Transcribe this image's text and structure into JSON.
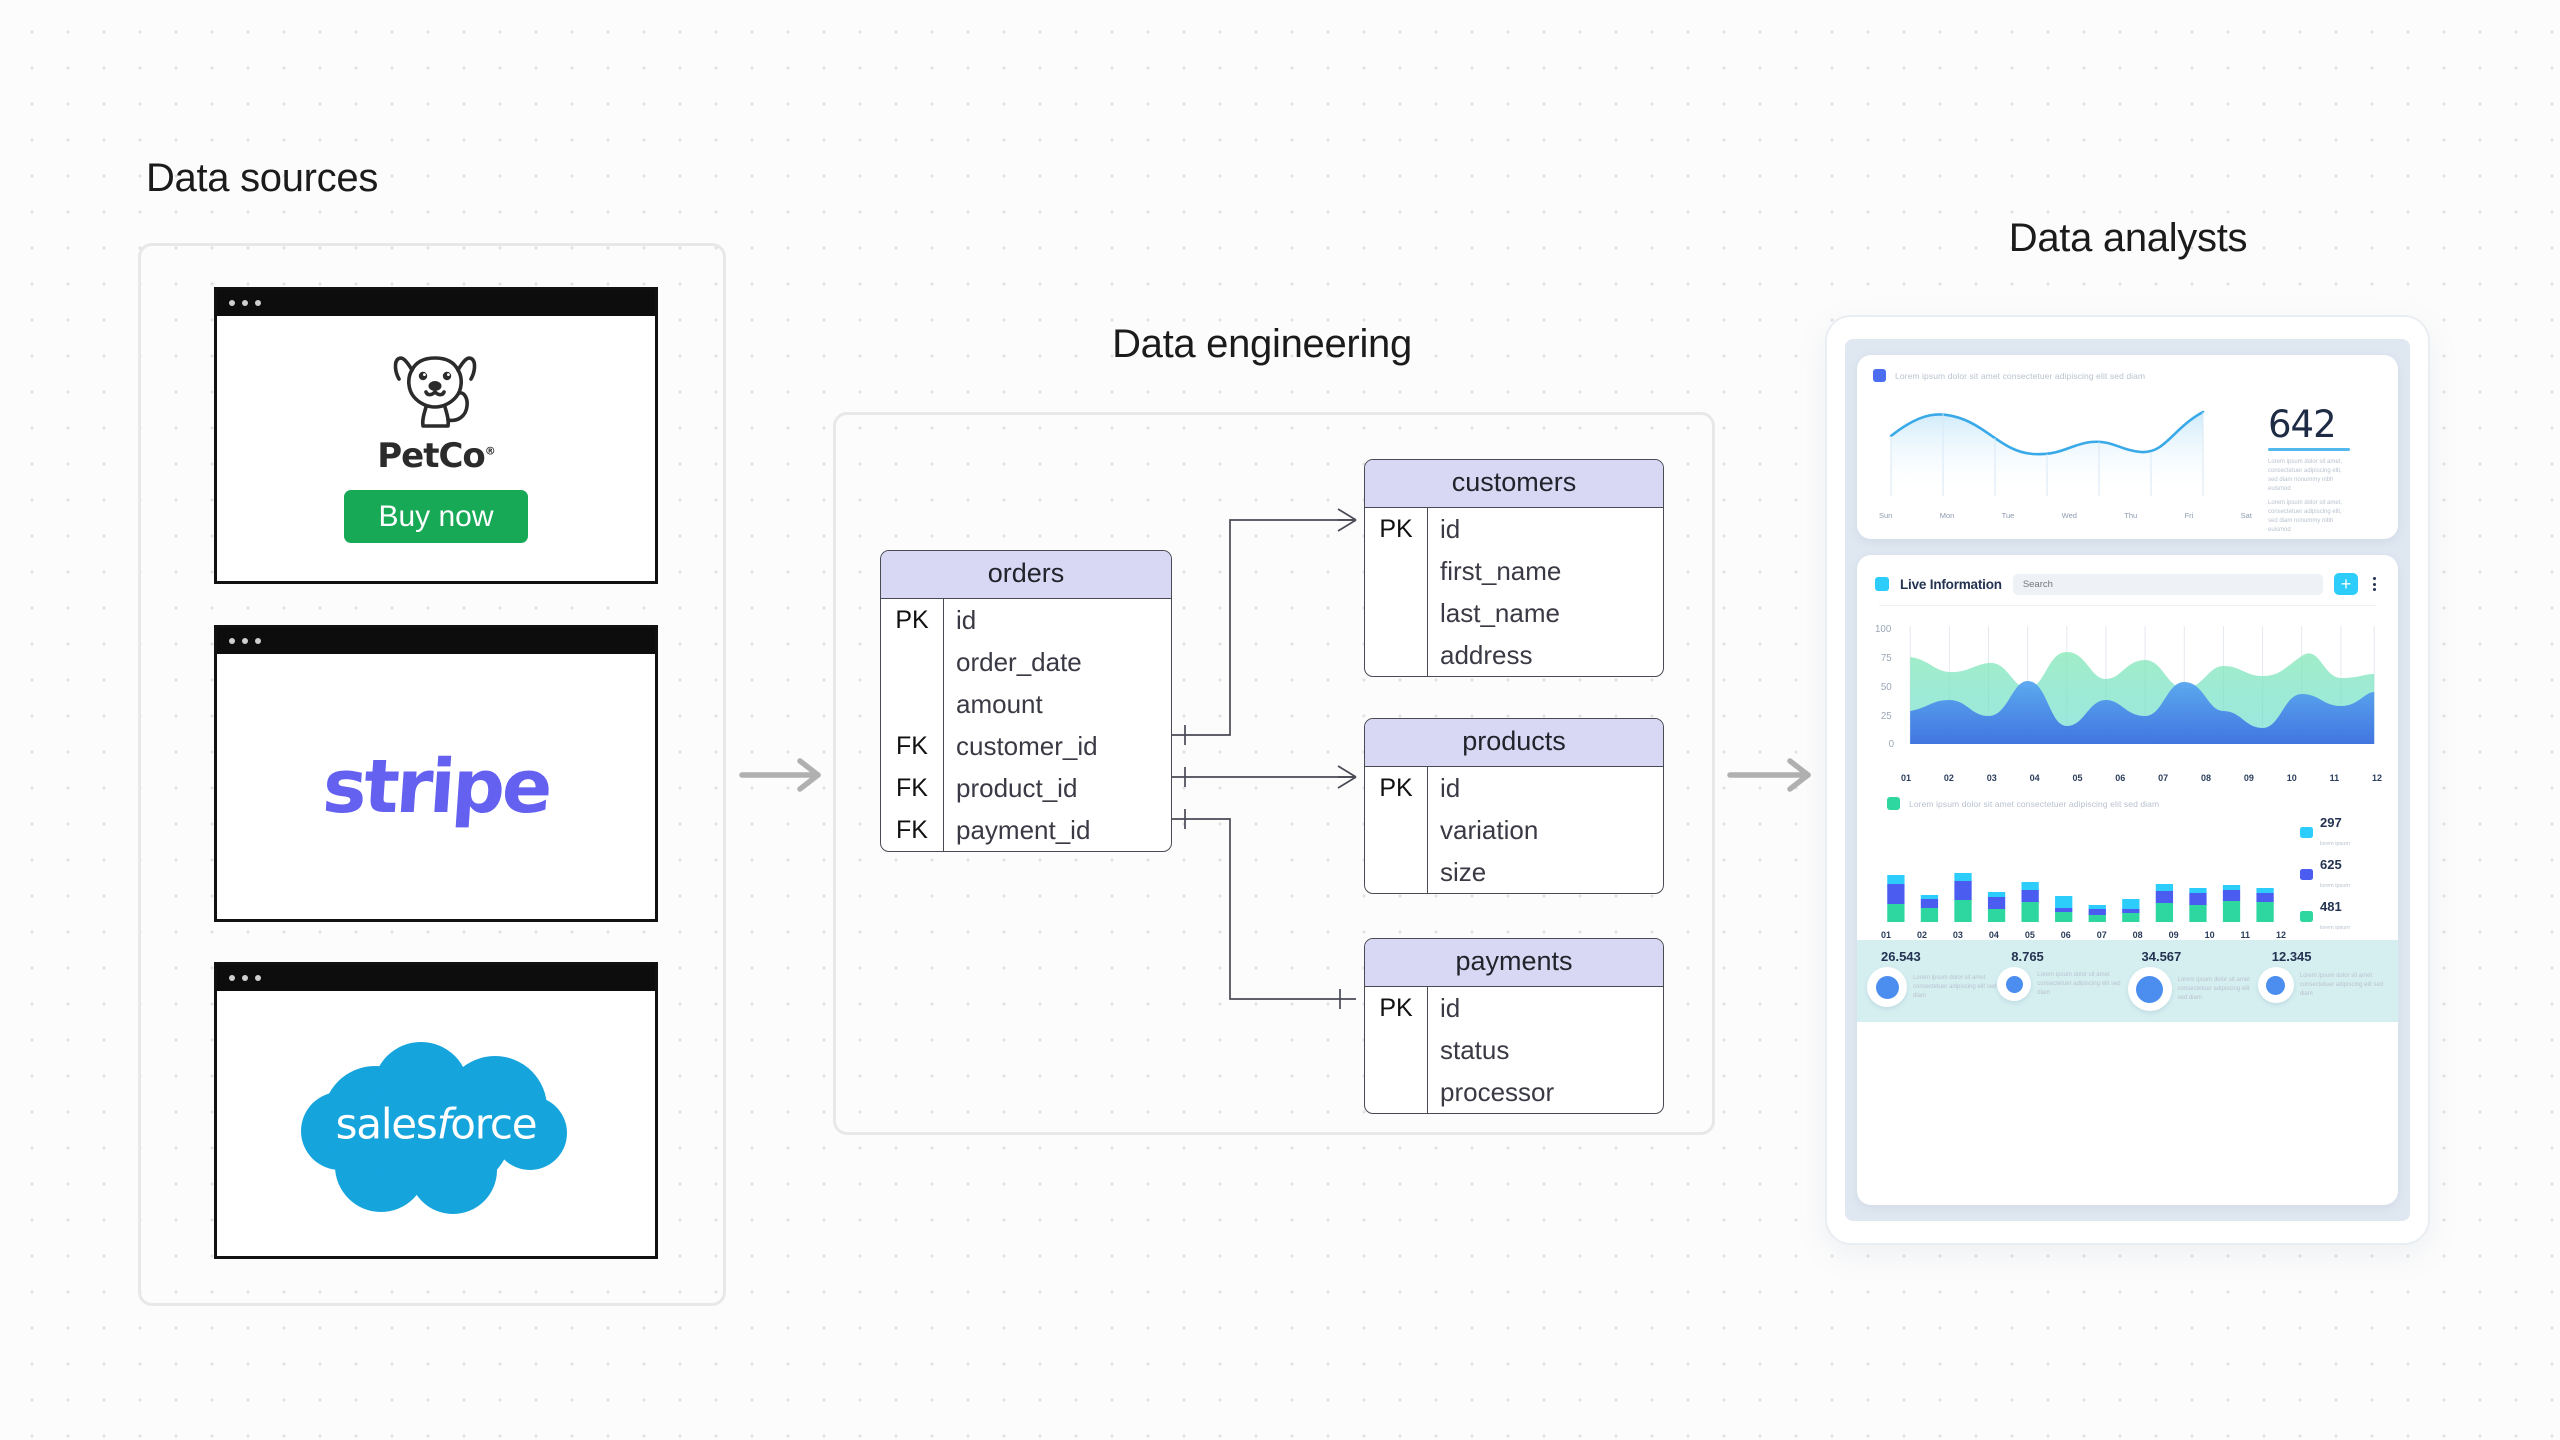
{
  "sections": {
    "sources_title": "Data sources",
    "engineering_title": "Data engineering",
    "analysts_title": "Data analysts"
  },
  "data_sources": {
    "windows": [
      {
        "name": "petco",
        "brand": "PetCo",
        "registered": "®",
        "cta": "Buy now",
        "cta_color": "#18a957"
      },
      {
        "name": "stripe",
        "brand": "stripe",
        "brand_color": "#6460f0"
      },
      {
        "name": "salesforce",
        "brand_lead": "sales",
        "brand_italic": "f",
        "brand_tail": "orce",
        "brand_color": "#16a4dd"
      }
    ]
  },
  "er_diagram": {
    "header_color": "#d8d8f5",
    "tables": [
      {
        "name": "orders",
        "columns": [
          {
            "key": "PK",
            "field": "id"
          },
          {
            "key": "",
            "field": "order_date"
          },
          {
            "key": "",
            "field": "amount"
          },
          {
            "key": "FK",
            "field": "customer_id"
          },
          {
            "key": "FK",
            "field": "product_id"
          },
          {
            "key": "FK",
            "field": "payment_id"
          }
        ]
      },
      {
        "name": "customers",
        "columns": [
          {
            "key": "PK",
            "field": "id"
          },
          {
            "key": "",
            "field": "first_name"
          },
          {
            "key": "",
            "field": "last_name"
          },
          {
            "key": "",
            "field": "address"
          }
        ]
      },
      {
        "name": "products",
        "columns": [
          {
            "key": "PK",
            "field": "id"
          },
          {
            "key": "",
            "field": "variation"
          },
          {
            "key": "",
            "field": "size"
          }
        ]
      },
      {
        "name": "payments",
        "columns": [
          {
            "key": "PK",
            "field": "id"
          },
          {
            "key": "",
            "field": "status"
          },
          {
            "key": "",
            "field": "processor"
          }
        ]
      }
    ],
    "relationships": [
      {
        "from": "orders.customer_id",
        "to": "customers.id"
      },
      {
        "from": "orders.product_id",
        "to": "products.id"
      },
      {
        "from": "orders.payment_id",
        "to": "payments.id"
      }
    ]
  },
  "flow_arrows": [
    {
      "name": "sources-to-engineering"
    },
    {
      "name": "engineering-to-analysts"
    }
  ],
  "dashboard": {
    "top_card": {
      "legend_label": "Lorem ipsum dolor sit amet consectetuer adipiscing elit sed diam",
      "legend_color": "#4b6ef0",
      "kpi_value": "642",
      "kpi_note_1": "Lorem ipsum dolor sit amet, consectetuer adipiscing elit, sed diam nonummy nibh euismod",
      "kpi_note_2": "Lorem ipsum dolor sit amet, consectetuer adipiscing elit, sed diam nonummy nibh euismod"
    },
    "live_card": {
      "title": "Live Information",
      "title_swatch_color": "#2ccdfb",
      "search_placeholder": "Search",
      "add_label": "+",
      "menu_label": "more-options",
      "bar_legend_label": "Lorem ipsum dolor sit amet consectetuer adipiscing elit sed diam"
    },
    "kpi_strip": [
      {
        "value": "26.543",
        "note": "Lorem ipsum dolor sit amet consectetuer adipiscing elit sed diam",
        "size": 23
      },
      {
        "value": "8.765",
        "note": "Lorem ipsum dolor sit amet consectetuer adipiscing elit sed diam",
        "size": 17
      },
      {
        "value": "34.567",
        "note": "Lorem ipsum dolor sit amet consectetuer adipiscing elit sed diam",
        "size": 27
      },
      {
        "value": "12.345",
        "note": "Lorem ipsum dolor sit amet consectetuer adipiscing elit sed diam",
        "size": 19
      }
    ]
  },
  "chart_data": [
    {
      "type": "line",
      "title": "Lorem ipsum dolor sit amet consectetuer adipiscing elit sed diam",
      "categories": [
        "Sun",
        "Mon",
        "Tue",
        "Wed",
        "Thu",
        "Fri",
        "Sat"
      ],
      "values": [
        52,
        66,
        48,
        38,
        44,
        38,
        72
      ],
      "ylim": [
        0,
        100
      ],
      "series_color": "#3aa9e8",
      "kpi": 642,
      "grid": false,
      "legend": "top-left"
    },
    {
      "type": "area",
      "categories": [
        "01",
        "02",
        "03",
        "04",
        "05",
        "06",
        "07",
        "08",
        "09",
        "10",
        "11",
        "12"
      ],
      "series": [
        {
          "name": "green",
          "color": "#6fe0b0",
          "values": [
            75,
            61,
            66,
            52,
            73,
            58,
            68,
            50,
            63,
            57,
            76,
            60
          ]
        },
        {
          "name": "blue",
          "color": "#4b8ef0",
          "values": [
            28,
            35,
            24,
            53,
            40,
            16,
            44,
            25,
            54,
            30,
            14,
            45
          ]
        }
      ],
      "ylim": [
        0,
        100
      ],
      "yticks": [
        0,
        25,
        50,
        75,
        100
      ],
      "xlabel": "",
      "ylabel": "",
      "grid": true
    },
    {
      "type": "bar",
      "stacked": true,
      "title": "Lorem ipsum dolor sit amet consectetuer adipiscing elit sed diam",
      "categories": [
        "01",
        "02",
        "03",
        "04",
        "05",
        "06",
        "07",
        "08",
        "09",
        "10",
        "11",
        "12"
      ],
      "series": [
        {
          "name": "481",
          "sub": "lorem ipsum",
          "color": "#2ed6a0",
          "values": [
            18,
            14,
            22,
            13,
            20,
            10,
            7,
            9,
            19,
            17,
            21,
            20
          ]
        },
        {
          "name": "625",
          "sub": "lorem ipsum",
          "color": "#4a5df0",
          "values": [
            20,
            9,
            19,
            12,
            12,
            4,
            6,
            4,
            12,
            12,
            11,
            9
          ]
        },
        {
          "name": "297",
          "sub": "lorem ipsum",
          "color": "#2ccdfb",
          "values": [
            9,
            4,
            8,
            5,
            8,
            12,
            4,
            10,
            7,
            5,
            5,
            5
          ]
        }
      ],
      "legend_values": [
        "297",
        "625",
        "481"
      ],
      "legend_position": "right"
    }
  ]
}
